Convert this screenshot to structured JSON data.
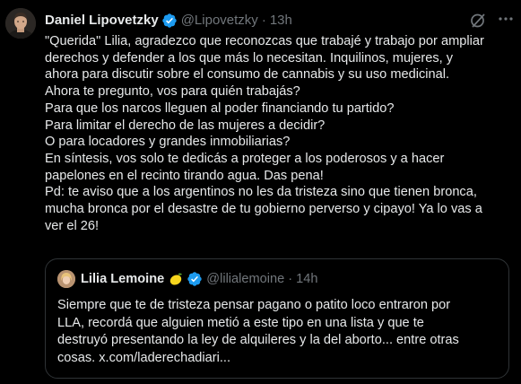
{
  "tweet": {
    "author_name": "Daniel Lipovetzky",
    "handle": "@Lipovetzky",
    "separator": "·",
    "time": "13h",
    "avatar_icon": "avatar-photo",
    "verified_icon": "verified-badge-icon",
    "grok_icon": "grok-icon",
    "more_icon": "more-dots-icon",
    "colors": {
      "verified": "#1d9bf0",
      "secondary_text": "#71767b",
      "text": "#e7e9ea",
      "border": "#2f3336",
      "background": "#000000"
    },
    "body_lines": [
      "\"Querida\" Lilia, agradezco que reconozcas que trabajé y trabajo por ampliar",
      "derechos y defender a los que más lo necesitan. Inquilinos, mujeres, y",
      "ahora para discutir sobre el consumo de cannabis y su uso medicinal.",
      "Ahora te pregunto, vos para quién trabajás?",
      "Para que los narcos lleguen al poder financiando tu partido?",
      "Para limitar el derecho de las mujeres a decidir?",
      "O para locadores y grandes inmobiliarias?",
      "En síntesis, vos solo te dedicás a proteger a los poderosos y  a hacer",
      "papelones en el recinto tirando agua. Das pena!",
      "Pd: te aviso que a los argentinos no les da tristeza sino que tienen bronca,",
      "mucha bronca por el desastre de tu gobierno perverso y cipayo! Ya lo vas a",
      "ver el 26!"
    ]
  },
  "quote": {
    "author_name": "Lilia Lemoine",
    "emoji_icon": "lemon-emoji-icon",
    "verified_icon": "verified-badge-icon",
    "handle": "@lilialemoine",
    "separator": "·",
    "time": "14h",
    "body_lines": [
      "Siempre que te de tristeza pensar pagano o patito loco entraron por",
      "LLA, recordá que alguien metió a este tipo en una lista y que te",
      "destruyó presentando la ley de alquileres y la del aborto... entre otras",
      "cosas. x.com/laderechadiari..."
    ]
  }
}
